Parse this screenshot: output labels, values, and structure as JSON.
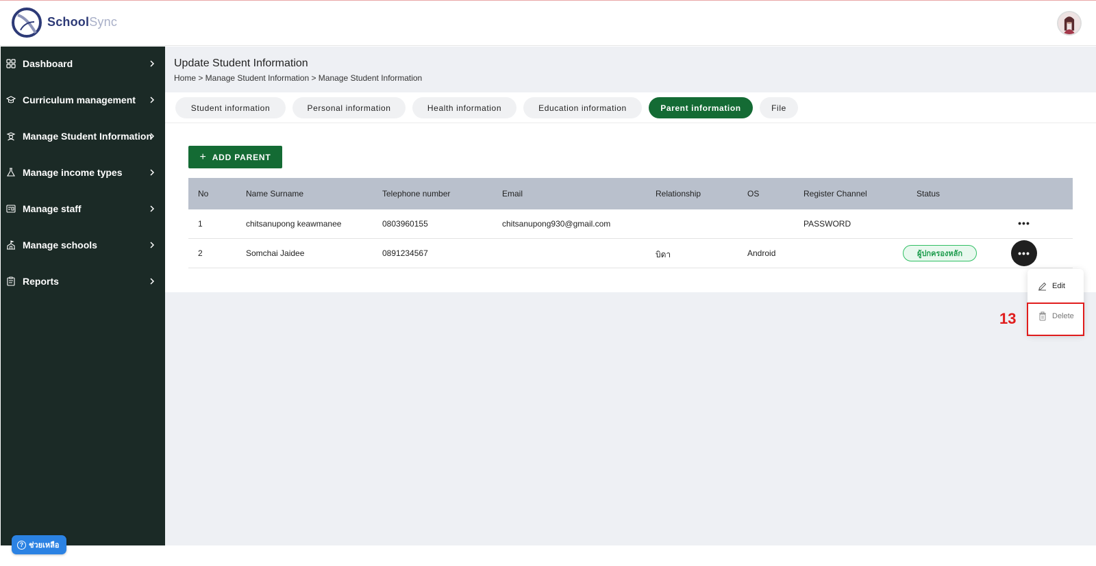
{
  "app": {
    "brand_part1": "School",
    "brand_part2": "Sync"
  },
  "sidebar": {
    "items": [
      {
        "label": "Dashboard",
        "icon": "grid-icon"
      },
      {
        "label": "Curriculum management",
        "icon": "graduation-cap-icon"
      },
      {
        "label": "Manage Student Information",
        "icon": "student-icon"
      },
      {
        "label": "Manage income types",
        "icon": "flask-icon"
      },
      {
        "label": "Manage staff",
        "icon": "id-card-icon"
      },
      {
        "label": "Manage schools",
        "icon": "school-icon"
      },
      {
        "label": "Reports",
        "icon": "clipboard-icon"
      }
    ],
    "help_label": "ช่วยเหลือ"
  },
  "page": {
    "title": "Update Student Information",
    "breadcrumb": "Home > Manage Student Information > Manage Student Information"
  },
  "tabs": [
    {
      "label": "Student information",
      "active": false
    },
    {
      "label": "Personal information",
      "active": false
    },
    {
      "label": "Health information",
      "active": false
    },
    {
      "label": "Education information",
      "active": false
    },
    {
      "label": "Parent information",
      "active": true
    },
    {
      "label": "File",
      "active": false
    }
  ],
  "add_button": {
    "plus": "+",
    "label": "ADD PARENT"
  },
  "table": {
    "headers": [
      "No",
      "Name Surname",
      "Telephone number",
      "Email",
      "Relationship",
      "OS",
      "Register Channel",
      "Status"
    ],
    "rows": [
      {
        "no": "1",
        "name": "chitsanupong keawmanee",
        "phone": "0803960155",
        "email": "chitsanupong930@gmail.com",
        "relationship": "",
        "os": "",
        "channel": "PASSWORD",
        "status": ""
      },
      {
        "no": "2",
        "name": "Somchai Jaidee",
        "phone": "0891234567",
        "email": "",
        "relationship": "บิดา",
        "os": "Android",
        "channel": "",
        "status": "ผู้ปกครองหลัก"
      }
    ],
    "more_glyph": "•••"
  },
  "context_menu": {
    "edit_label": "Edit",
    "delete_label": "Delete"
  },
  "annotation": {
    "step_number": "13",
    "color": "#e01c1c"
  },
  "colors": {
    "sidebar_bg": "#1b2a26",
    "primary_green": "#146b34",
    "table_header": "#b9c0cc"
  }
}
